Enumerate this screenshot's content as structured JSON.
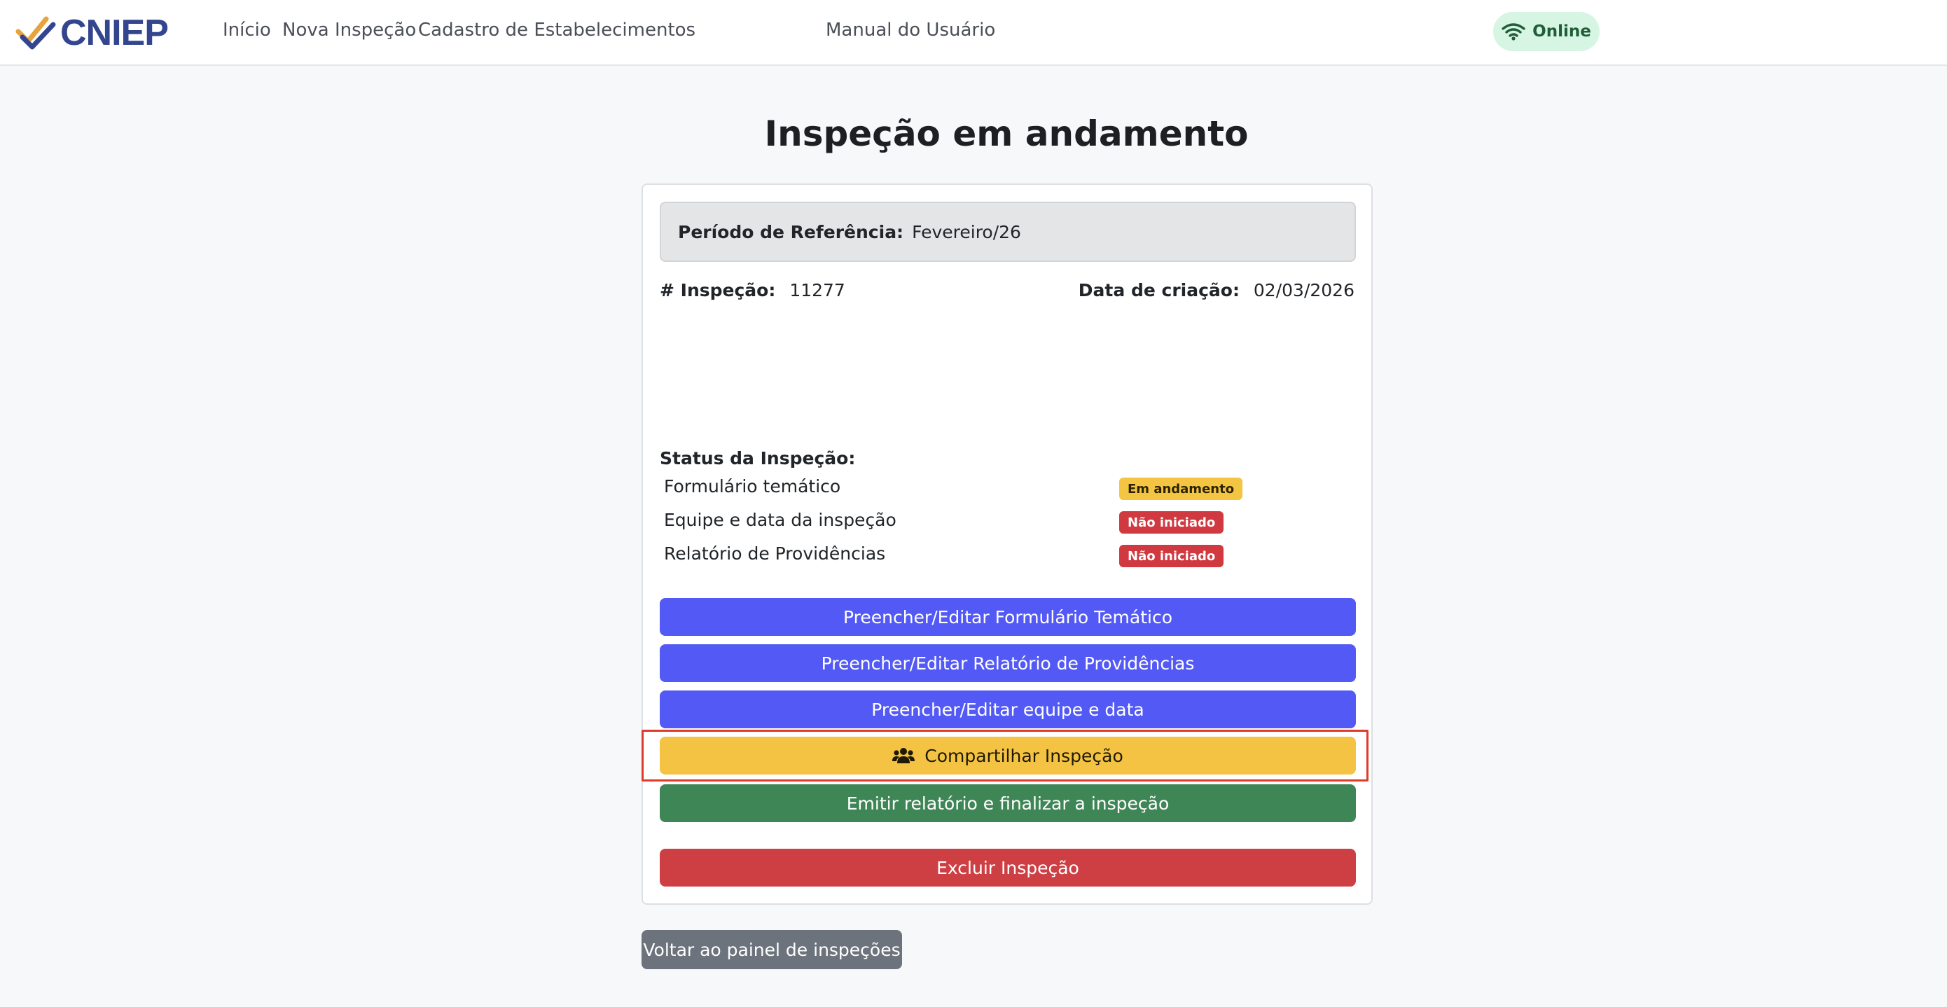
{
  "brand": {
    "name": "CNIEP",
    "icon": "check-logo-icon"
  },
  "nav": {
    "items": [
      "Início",
      "Nova Inspeção",
      "Cadastro de Estabelecimentos",
      "Manual do Usuário"
    ]
  },
  "connection": {
    "label": "Online",
    "icon": "wifi-icon"
  },
  "page": {
    "title": "Inspeção em andamento"
  },
  "card": {
    "reference_label": "Período de Referência:",
    "reference_value": "Fevereiro/26",
    "inspection_label": "# Inspeção:",
    "inspection_value": "11277",
    "created_label": "Data de criação:",
    "created_value": "02/03/2026",
    "status_title": "Status da Inspeção:",
    "status_items": [
      {
        "name": "Formulário temático",
        "status": "Em andamento",
        "variant": "warning"
      },
      {
        "name": "Equipe e data da inspeção",
        "status": "Não iniciado",
        "variant": "danger"
      },
      {
        "name": "Relatório de Providências",
        "status": "Não iniciado",
        "variant": "danger"
      }
    ]
  },
  "actions": {
    "edit_form": "Preencher/Editar Formulário Temático",
    "edit_report": "Preencher/Editar Relatório de Providências",
    "edit_team": "Preencher/Editar equipe e data",
    "share": "Compartilhar Inspeção",
    "share_icon": "users-icon",
    "finalize": "Emitir relatório e finalizar a inspeção",
    "delete": "Excluir Inspeção",
    "back": "Voltar ao painel de inspeções"
  },
  "colors": {
    "primary": "#5359f5",
    "warning": "#f5c343",
    "success": "#3f8656",
    "danger": "#ce3f44",
    "brand": "#33458f",
    "highlight": "#e03a2b"
  }
}
